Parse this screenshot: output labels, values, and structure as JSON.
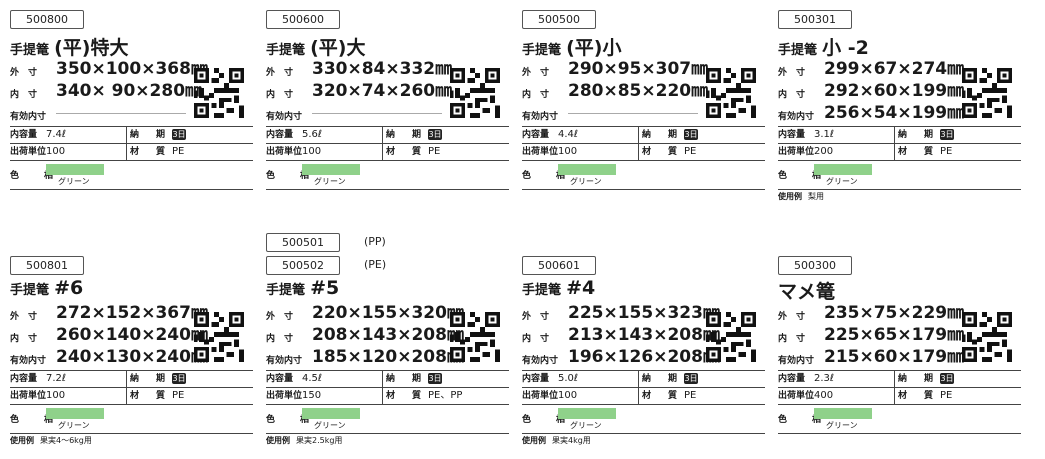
{
  "labels": {
    "outer": "外　寸",
    "inner": "内　寸",
    "effective": "有効内寸",
    "capacity": "内容量",
    "lead": "納　期",
    "unit": "出荷単位",
    "material": "材　質",
    "color": "色　相",
    "usage": "使用例"
  },
  "cards": [
    {
      "code": "500800",
      "prefix": "手提篭",
      "main": "(平)特大",
      "outer": "350×100×368㎜",
      "inner": "340×  90×280㎜",
      "effective": "",
      "capacity": "7.4ℓ",
      "lead": "3日",
      "unit": "100",
      "material": "PE",
      "color": "グリーン",
      "usage": ""
    },
    {
      "code": "500600",
      "prefix": "手提篭",
      "main": "(平)大",
      "outer": "330×84×332㎜",
      "inner": "320×74×260㎜",
      "effective": "",
      "capacity": "5.6ℓ",
      "lead": "3日",
      "unit": "100",
      "material": "PE",
      "color": "グリーン",
      "usage": ""
    },
    {
      "code": "500500",
      "prefix": "手提篭",
      "main": "(平)小",
      "outer": "290×95×307㎜",
      "inner": "280×85×220㎜",
      "effective": "",
      "capacity": "4.4ℓ",
      "lead": "3日",
      "unit": "100",
      "material": "PE",
      "color": "グリーン",
      "usage": ""
    },
    {
      "code": "500301",
      "prefix": "手提篭",
      "main": "小 -2",
      "outer": "299×67×274㎜",
      "inner": "292×60×199㎜",
      "effective": "256×54×199㎜",
      "capacity": "3.1ℓ",
      "lead": "3日",
      "unit": "200",
      "material": "PE",
      "color": "グリーン",
      "usage": "梨用"
    },
    {
      "code": "500801",
      "prefix": "手提篭",
      "main": "#6",
      "outer": "272×152×367㎜",
      "inner": "260×140×240㎜",
      "effective": "240×130×240㎜",
      "capacity": "7.2ℓ",
      "lead": "3日",
      "unit": "100",
      "material": "PE",
      "color": "グリーン",
      "usage": "果実4～6kg用"
    },
    {
      "code": "500502",
      "code_top": "500501",
      "note_top": "(PP)",
      "note": "(PE)",
      "prefix": "手提篭",
      "main": "#5",
      "outer": "220×155×320㎜",
      "inner": "208×143×208㎜",
      "effective": "185×120×208㎜",
      "capacity": "4.5ℓ",
      "lead": "3日",
      "unit": "150",
      "material": "PE、PP",
      "color": "グリーン",
      "usage": "果実2.5kg用"
    },
    {
      "code": "500601",
      "prefix": "手提篭",
      "main": "#4",
      "outer": "225×155×323㎜",
      "inner": "213×143×208㎜",
      "effective": "196×126×208㎜",
      "capacity": "5.0ℓ",
      "lead": "3日",
      "unit": "100",
      "material": "PE",
      "color": "グリーン",
      "usage": "果実4kg用"
    },
    {
      "code": "500300",
      "prefix": "",
      "main": "マメ篭",
      "outer": "235×75×229㎜",
      "inner": "225×65×179㎜",
      "effective": "215×60×179㎜",
      "capacity": "2.3ℓ",
      "lead": "3日",
      "unit": "400",
      "material": "PE",
      "color": "グリーン",
      "usage": ""
    }
  ],
  "colors": {
    "swatch": "#8fd18a",
    "text": "#1a1a1a"
  }
}
